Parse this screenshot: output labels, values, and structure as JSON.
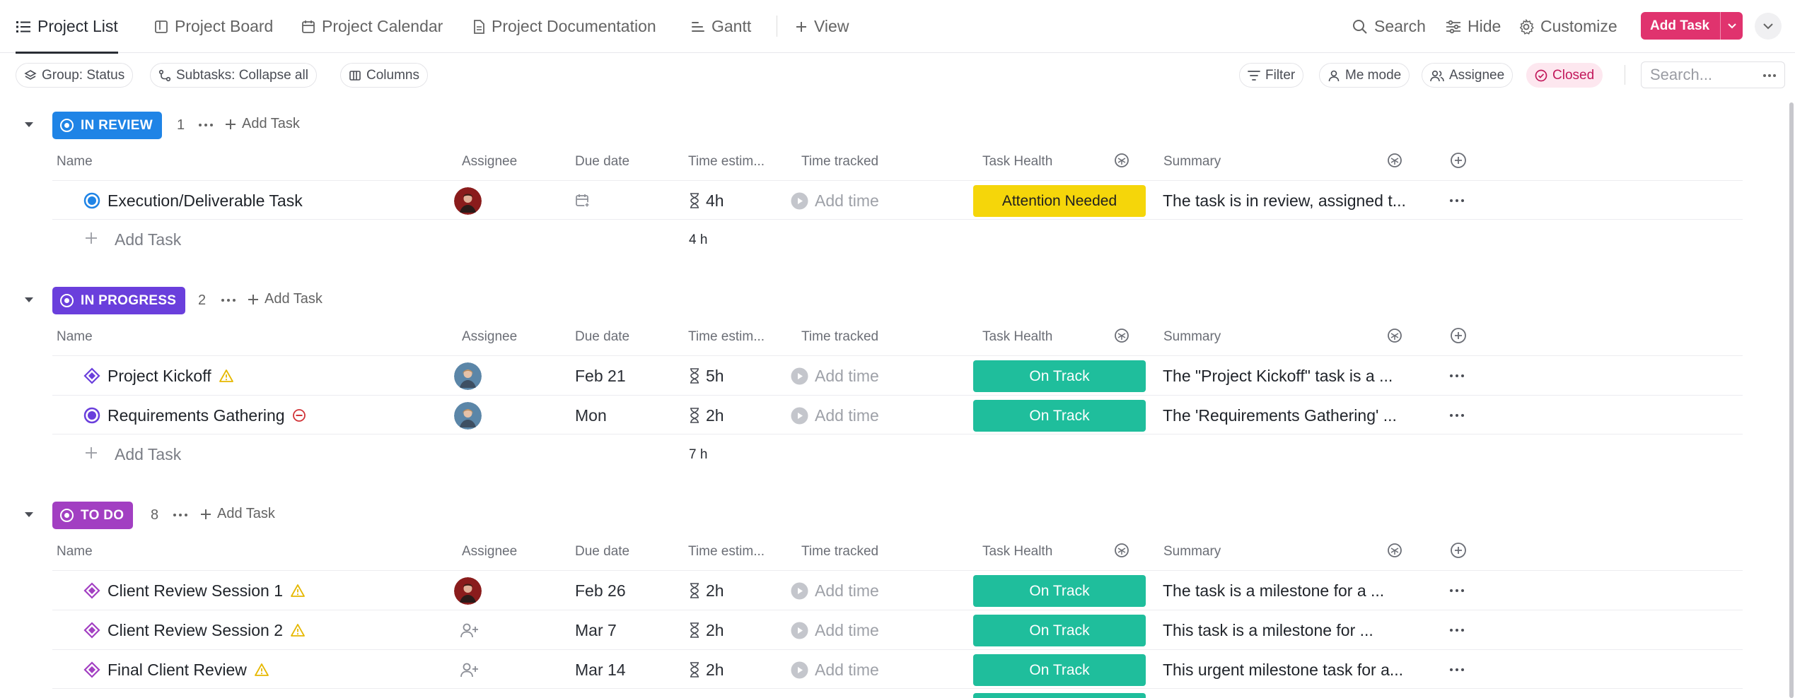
{
  "tabs": [
    {
      "label": "Project List",
      "icon": "list-icon",
      "active": true
    },
    {
      "label": "Project Board",
      "icon": "board-icon",
      "active": false
    },
    {
      "label": "Project Calendar",
      "icon": "calendar-icon",
      "active": false
    },
    {
      "label": "Project Documentation",
      "icon": "doc-icon",
      "active": false
    },
    {
      "label": "Gantt",
      "icon": "gantt-icon",
      "active": false
    },
    {
      "label": "View",
      "icon": "plus-icon",
      "active": false
    }
  ],
  "toolbar": {
    "search_label": "Search",
    "hide_label": "Hide",
    "customize_label": "Customize",
    "add_task_label": "Add Task"
  },
  "filters": {
    "group": "Group: Status",
    "subtasks": "Subtasks: Collapse all",
    "columns": "Columns",
    "filter": "Filter",
    "me_mode": "Me mode",
    "assignee": "Assignee",
    "closed": "Closed",
    "search_placeholder": "Search..."
  },
  "columns": {
    "name": "Name",
    "assignee": "Assignee",
    "due_date": "Due date",
    "time_estimate": "Time estim...",
    "time_tracked": "Time tracked",
    "task_health": "Task Health",
    "summary": "Summary"
  },
  "colors": {
    "in_review": "#1f84e6",
    "in_progress": "#6a3fdc",
    "to_do": "#a23fc2",
    "on_track": "#1fbe9c",
    "attention": "#f5d60a",
    "add_task": "#e0336e"
  },
  "groups": [
    {
      "status": "IN REVIEW",
      "count": "1",
      "add_label": "Add Task",
      "total": "4 h",
      "tasks": [
        {
          "name": "Execution/Deliverable Task",
          "due": "",
          "estimate": "4h",
          "tracked": "Add time",
          "health": "Attention Needed",
          "summary": "The task is in review, assigned t..."
        }
      ]
    },
    {
      "status": "IN PROGRESS",
      "count": "2",
      "add_label": "Add Task",
      "total": "7 h",
      "tasks": [
        {
          "name": "Project Kickoff",
          "due": "Feb 21",
          "estimate": "5h",
          "tracked": "Add time",
          "health": "On Track",
          "summary": "The \"Project Kickoff\" task is a ..."
        },
        {
          "name": "Requirements Gathering",
          "due": "Mon",
          "estimate": "2h",
          "tracked": "Add time",
          "health": "On Track",
          "summary": "The 'Requirements Gathering' ..."
        }
      ]
    },
    {
      "status": "TO DO",
      "count": "8",
      "add_label": "Add Task",
      "tasks": [
        {
          "name": "Client Review Session 1",
          "due": "Feb 26",
          "estimate": "2h",
          "tracked": "Add time",
          "health": "On Track",
          "summary": "The task is a milestone for a ..."
        },
        {
          "name": "Client Review Session 2",
          "due": "Mar 7",
          "estimate": "2h",
          "tracked": "Add time",
          "health": "On Track",
          "summary": "This task is a milestone for ..."
        },
        {
          "name": "Final Client Review",
          "due": "Mar 14",
          "estimate": "2h",
          "tracked": "Add time",
          "health": "On Track",
          "summary": "This urgent milestone task for a..."
        }
      ]
    }
  ]
}
